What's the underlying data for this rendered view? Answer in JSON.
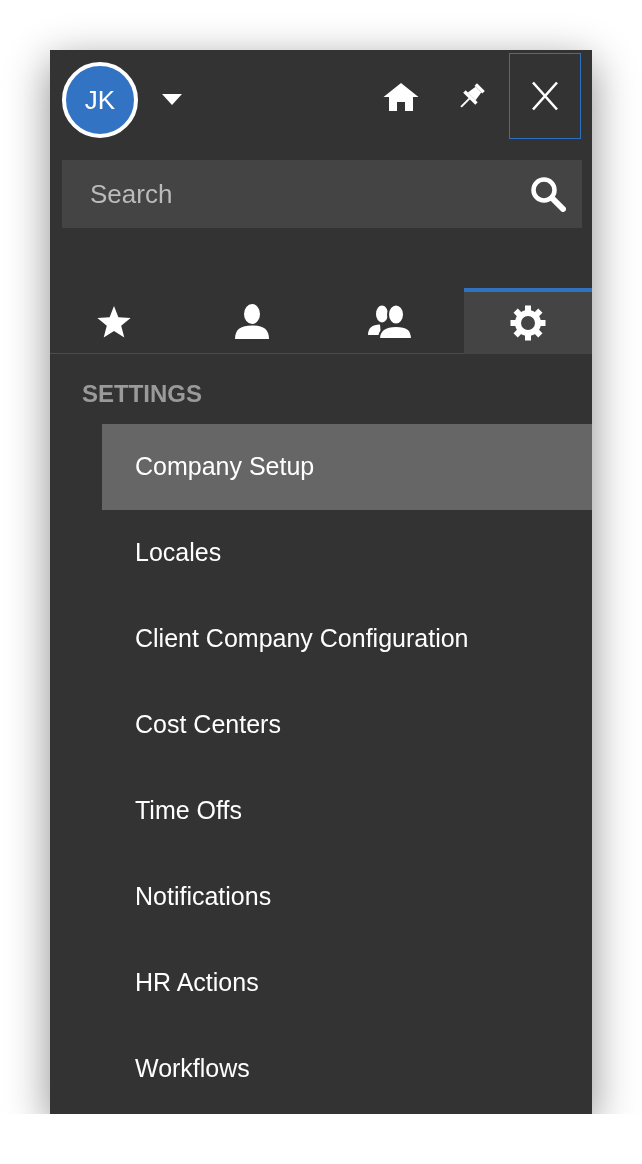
{
  "header": {
    "avatar": {
      "initials": "JK"
    }
  },
  "search": {
    "placeholder": "Search"
  },
  "tabs": [
    {
      "selected": false
    },
    {
      "selected": false
    },
    {
      "selected": false
    },
    {
      "selected": true
    }
  ],
  "settings": {
    "heading": "SETTINGS",
    "items": [
      {
        "label": "Company Setup",
        "selected": true
      },
      {
        "label": "Locales",
        "selected": false
      },
      {
        "label": "Client Company Configuration",
        "selected": false
      },
      {
        "label": "Cost Centers",
        "selected": false
      },
      {
        "label": "Time Offs",
        "selected": false
      },
      {
        "label": "Notifications",
        "selected": false
      },
      {
        "label": "HR Actions",
        "selected": false
      },
      {
        "label": "Workflows",
        "selected": false
      }
    ]
  }
}
